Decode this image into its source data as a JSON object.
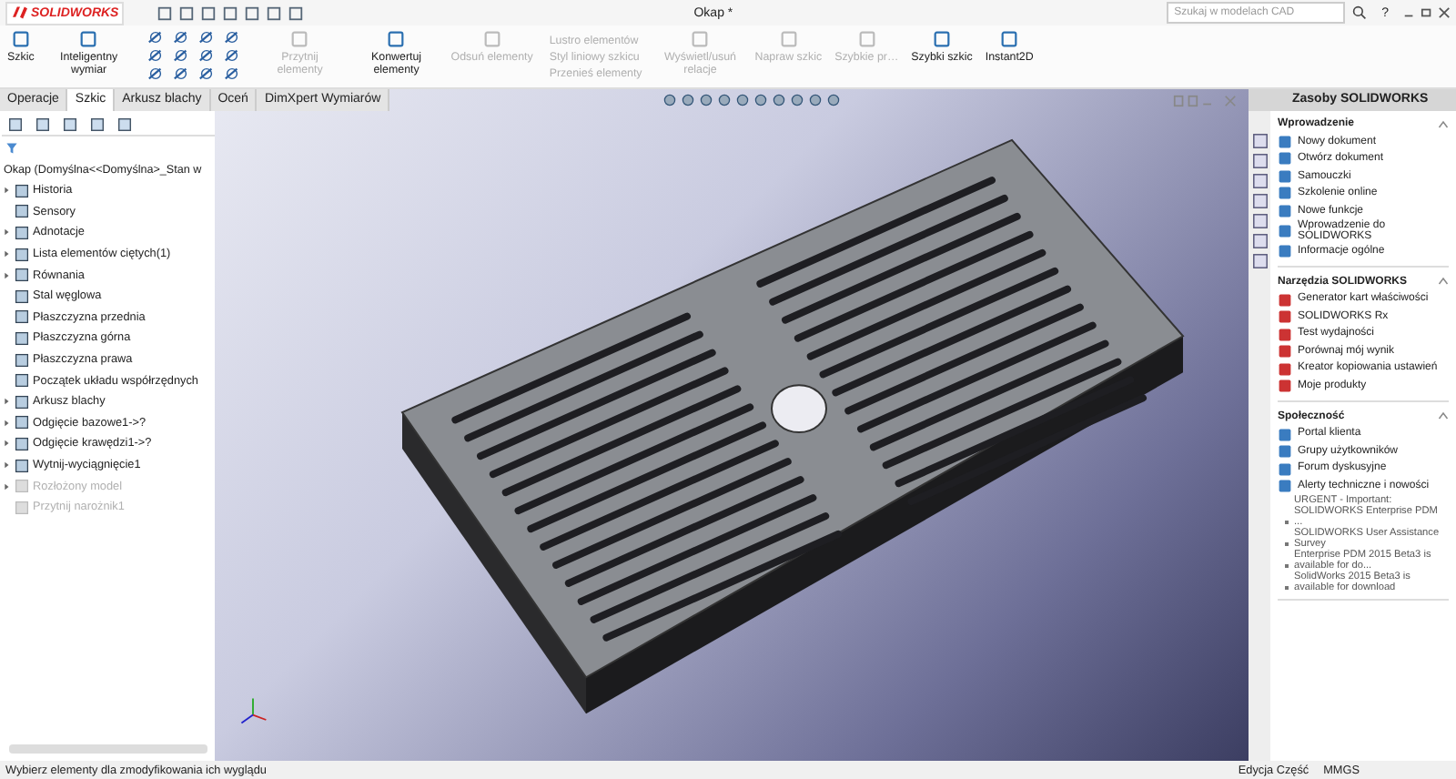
{
  "app": {
    "logo": "SOLIDWORKS",
    "title": "Okap *",
    "search": {
      "placeholder": "Szukaj w modelach CAD"
    },
    "help": "?"
  },
  "ribbon": [
    {
      "kind": "large",
      "label": "Szkic",
      "disabled": false
    },
    {
      "kind": "large",
      "label": "Inteligentny wymiar",
      "disabled": false
    },
    {
      "kind": "tools"
    },
    {
      "kind": "large",
      "label": "Przytnij elementy",
      "disabled": true
    },
    {
      "kind": "large",
      "label": "Konwertuj elementy",
      "disabled": false
    },
    {
      "kind": "large",
      "label": "Odsuń elementy",
      "disabled": true
    },
    {
      "kind": "small",
      "rows": [
        {
          "label": "Lustro elementów",
          "disabled": true
        },
        {
          "label": "Styl liniowy szkicu",
          "disabled": true
        },
        {
          "label": "Przenieś elementy",
          "disabled": true
        }
      ]
    },
    {
      "kind": "large",
      "label": "Wyświetl/usuń relacje",
      "disabled": true
    },
    {
      "kind": "large",
      "label": "Napraw szkic",
      "disabled": true
    },
    {
      "kind": "large",
      "label": "Szybkie pr…",
      "disabled": true
    },
    {
      "kind": "large",
      "label": "Szybki szkic",
      "disabled": false
    },
    {
      "kind": "large",
      "label": "Instant2D",
      "disabled": false
    }
  ],
  "tabs": [
    {
      "label": "Operacje",
      "selected": false
    },
    {
      "label": "Szkic",
      "selected": true
    },
    {
      "label": "Arkusz blachy",
      "selected": false
    },
    {
      "label": "Oceń",
      "selected": false
    },
    {
      "label": "DimXpert Wymiarów",
      "selected": false
    }
  ],
  "tree": {
    "root": "Okap  (Domyślna<<Domyślna>_Stan w",
    "items": [
      {
        "label": "Historia",
        "collapsed": true,
        "disabled": false
      },
      {
        "label": "Sensory",
        "collapsed": false,
        "disabled": false
      },
      {
        "label": "Adnotacje",
        "collapsed": true,
        "disabled": false
      },
      {
        "label": "Lista elementów ciętych(1)",
        "collapsed": true,
        "disabled": false
      },
      {
        "label": "Równania",
        "collapsed": true,
        "disabled": false
      },
      {
        "label": "Stal węglowa",
        "collapsed": false,
        "disabled": false
      },
      {
        "label": "Płaszczyzna przednia",
        "collapsed": false,
        "disabled": false
      },
      {
        "label": "Płaszczyzna górna",
        "collapsed": false,
        "disabled": false
      },
      {
        "label": "Płaszczyzna prawa",
        "collapsed": false,
        "disabled": false
      },
      {
        "label": "Początek układu współrzędnych",
        "collapsed": false,
        "disabled": false
      },
      {
        "label": "Arkusz blachy",
        "collapsed": true,
        "disabled": false
      },
      {
        "label": "Odgięcie bazowe1->?",
        "collapsed": true,
        "disabled": false
      },
      {
        "label": "Odgięcie krawędzi1->?",
        "collapsed": true,
        "disabled": false
      },
      {
        "label": "Wytnij-wyciągnięcie1",
        "collapsed": true,
        "disabled": false
      },
      {
        "label": "Rozłożony model",
        "collapsed": true,
        "disabled": true
      },
      {
        "label": "Przytnij narożnik1",
        "collapsed": false,
        "disabled": true
      }
    ]
  },
  "taskpane": {
    "title": "Zasoby SOLIDWORKS",
    "sections": [
      {
        "title": "Wprowadzenie",
        "expanded": true,
        "items": [
          {
            "kind": "link",
            "label": "Nowy dokument"
          },
          {
            "kind": "link",
            "label": "Otwórz dokument"
          },
          {
            "kind": "link",
            "label": "Samouczki"
          },
          {
            "kind": "link",
            "label": "Szkolenie online"
          },
          {
            "kind": "link",
            "label": "Nowe funkcje"
          },
          {
            "kind": "link",
            "label": "Wprowadzenie do SOLIDWORKS"
          },
          {
            "kind": "link",
            "label": "Informacje ogólne"
          }
        ]
      },
      {
        "title": "Narzędzia SOLIDWORKS",
        "expanded": true,
        "items": [
          {
            "kind": "link",
            "label": "Generator kart właściwości"
          },
          {
            "kind": "link",
            "label": "SOLIDWORKS Rx"
          },
          {
            "kind": "link",
            "label": "Test wydajności"
          },
          {
            "kind": "link",
            "label": "Porównaj mój wynik"
          },
          {
            "kind": "link",
            "label": "Kreator kopiowania ustawień"
          },
          {
            "kind": "link",
            "label": "Moje produkty"
          }
        ]
      },
      {
        "title": "Społeczność",
        "expanded": true,
        "items": [
          {
            "kind": "link",
            "label": "Portal klienta"
          },
          {
            "kind": "link",
            "label": "Grupy użytkowników"
          },
          {
            "kind": "link",
            "label": "Forum dyskusyjne"
          },
          {
            "kind": "link",
            "label": "Alerty techniczne i nowości"
          },
          {
            "kind": "news",
            "label": "URGENT - Important: SOLIDWORKS Enterprise PDM ..."
          },
          {
            "kind": "news",
            "label": "SOLIDWORKS User Assistance Survey"
          },
          {
            "kind": "news",
            "label": "Enterprise PDM 2015 Beta3 is available for do..."
          },
          {
            "kind": "news",
            "label": "SolidWorks 2015 Beta3 is available for download"
          }
        ]
      }
    ]
  },
  "status_bar": {
    "message": "Wybierz elementy dla zmodyfikowania ich wyglądu",
    "mode": "Edycja Część",
    "units": "MMGS"
  }
}
